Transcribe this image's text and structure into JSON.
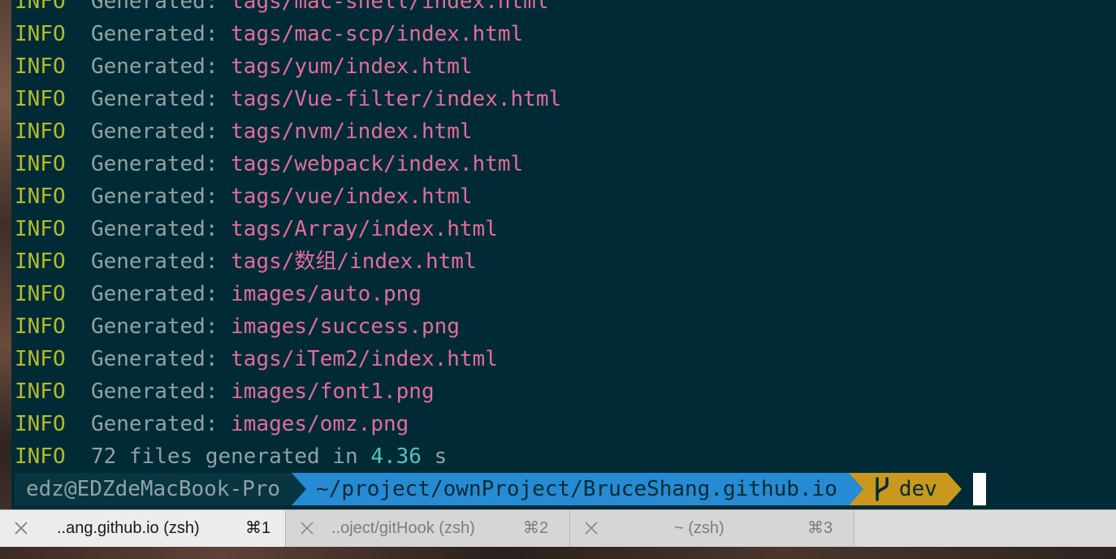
{
  "terminal": {
    "lines": [
      {
        "level": "INFO",
        "label": "Generated:",
        "path": "tags/mac-shell/index.html"
      },
      {
        "level": "INFO",
        "label": "Generated:",
        "path": "tags/mac-scp/index.html"
      },
      {
        "level": "INFO",
        "label": "Generated:",
        "path": "tags/yum/index.html"
      },
      {
        "level": "INFO",
        "label": "Generated:",
        "path": "tags/Vue-filter/index.html"
      },
      {
        "level": "INFO",
        "label": "Generated:",
        "path": "tags/nvm/index.html"
      },
      {
        "level": "INFO",
        "label": "Generated:",
        "path": "tags/webpack/index.html"
      },
      {
        "level": "INFO",
        "label": "Generated:",
        "path": "tags/vue/index.html"
      },
      {
        "level": "INFO",
        "label": "Generated:",
        "path": "tags/Array/index.html"
      },
      {
        "level": "INFO",
        "label": "Generated:",
        "path": "tags/数组/index.html"
      },
      {
        "level": "INFO",
        "label": "Generated:",
        "path": "images/auto.png"
      },
      {
        "level": "INFO",
        "label": "Generated:",
        "path": "images/success.png"
      },
      {
        "level": "INFO",
        "label": "Generated:",
        "path": "tags/iTem2/index.html"
      },
      {
        "level": "INFO",
        "label": "Generated:",
        "path": "images/font1.png"
      },
      {
        "level": "INFO",
        "label": "Generated:",
        "path": "images/omz.png"
      }
    ],
    "summary": {
      "level": "INFO",
      "text_before": "72 files generated in",
      "duration": "4.36",
      "unit": "s"
    },
    "prompt": {
      "user_host": "edz@EDZdeMacBook-Pro",
      "cwd": "~/project/ownProject/BruceShang.github.io",
      "branch": "dev",
      "branch_icon": "git-branch-icon"
    },
    "colors": {
      "background": "#002b36",
      "info": "#b5ba2a",
      "generated_label": "#93a1a1",
      "path": "#e26d9a",
      "number": "#56c2bd",
      "prompt_user_bg": "#073642",
      "prompt_dir_bg": "#268bd2",
      "prompt_git_bg": "#c9981c"
    }
  },
  "tabs": [
    {
      "title": "..ang.github.io (zsh)",
      "shortcut": "⌘1",
      "active": true
    },
    {
      "title": "..oject/gitHook (zsh)",
      "shortcut": "⌘2",
      "active": false
    },
    {
      "title": "~ (zsh)",
      "shortcut": "⌘3",
      "active": false
    }
  ]
}
